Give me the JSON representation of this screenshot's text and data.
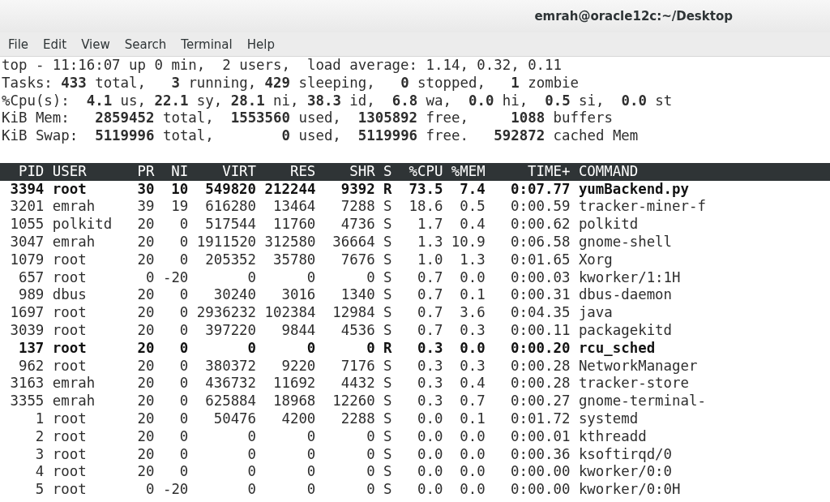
{
  "window": {
    "title": "emrah@oracle12c:~/Desktop"
  },
  "menu": [
    "File",
    "Edit",
    "View",
    "Search",
    "Terminal",
    "Help"
  ],
  "summary": [
    "top - 11:16:07 up 0 min,  2 users,  load average: 1.14, 0.32, 0.11",
    "Tasks: **433** total,   **3** running, **429** sleeping,   **0** stopped,   **1** zombie",
    "%Cpu(s):  **4.1** us, **22.1** sy, **28.1** ni, **38.3** id,  **6.8** wa,  **0.0** hi,  **0.5** si,  **0.0** st",
    "KiB Mem:   **2859452** total,  **1553560** used,  **1305892** free,     **1088** buffers",
    "KiB Swap:  **5119996** total,        **0** used,  **5119996** free.   **592872** cached Mem"
  ],
  "table": {
    "columns": [
      "PID",
      "USER",
      "PR",
      "NI",
      "VIRT",
      "RES",
      "SHR",
      "S",
      "%CPU",
      "%MEM",
      "TIME+",
      "COMMAND"
    ],
    "rows": [
      {
        "highlighted": true,
        "cells": [
          "3394",
          "root",
          "30",
          "10",
          "549820",
          "212244",
          "9392",
          "R",
          "73.5",
          "7.4",
          "0:07.77",
          "yumBackend.py"
        ]
      },
      {
        "highlighted": false,
        "cells": [
          "3201",
          "emrah",
          "39",
          "19",
          "616280",
          "13464",
          "7288",
          "S",
          "18.6",
          "0.5",
          "0:00.59",
          "tracker-miner-f"
        ]
      },
      {
        "highlighted": false,
        "cells": [
          "1055",
          "polkitd",
          "20",
          "0",
          "517544",
          "11760",
          "4736",
          "S",
          "1.7",
          "0.4",
          "0:00.62",
          "polkitd"
        ]
      },
      {
        "highlighted": false,
        "cells": [
          "3047",
          "emrah",
          "20",
          "0",
          "1911520",
          "312580",
          "36664",
          "S",
          "1.3",
          "10.9",
          "0:06.58",
          "gnome-shell"
        ]
      },
      {
        "highlighted": false,
        "cells": [
          "1079",
          "root",
          "20",
          "0",
          "205352",
          "35780",
          "7676",
          "S",
          "1.0",
          "1.3",
          "0:01.65",
          "Xorg"
        ]
      },
      {
        "highlighted": false,
        "cells": [
          "657",
          "root",
          "0",
          "-20",
          "0",
          "0",
          "0",
          "S",
          "0.7",
          "0.0",
          "0:00.03",
          "kworker/1:1H"
        ]
      },
      {
        "highlighted": false,
        "cells": [
          "989",
          "dbus",
          "20",
          "0",
          "30240",
          "3016",
          "1340",
          "S",
          "0.7",
          "0.1",
          "0:00.31",
          "dbus-daemon"
        ]
      },
      {
        "highlighted": false,
        "cells": [
          "1697",
          "root",
          "20",
          "0",
          "2936232",
          "102384",
          "12984",
          "S",
          "0.7",
          "3.6",
          "0:04.35",
          "java"
        ]
      },
      {
        "highlighted": false,
        "cells": [
          "3039",
          "root",
          "20",
          "0",
          "397220",
          "9844",
          "4536",
          "S",
          "0.7",
          "0.3",
          "0:00.11",
          "packagekitd"
        ]
      },
      {
        "highlighted": true,
        "cells": [
          "137",
          "root",
          "20",
          "0",
          "0",
          "0",
          "0",
          "R",
          "0.3",
          "0.0",
          "0:00.20",
          "rcu_sched"
        ]
      },
      {
        "highlighted": false,
        "cells": [
          "962",
          "root",
          "20",
          "0",
          "380372",
          "9220",
          "7176",
          "S",
          "0.3",
          "0.3",
          "0:00.28",
          "NetworkManager"
        ]
      },
      {
        "highlighted": false,
        "cells": [
          "3163",
          "emrah",
          "20",
          "0",
          "436732",
          "11692",
          "4432",
          "S",
          "0.3",
          "0.4",
          "0:00.28",
          "tracker-store"
        ]
      },
      {
        "highlighted": false,
        "cells": [
          "3355",
          "emrah",
          "20",
          "0",
          "625884",
          "18968",
          "12260",
          "S",
          "0.3",
          "0.7",
          "0:00.27",
          "gnome-terminal-"
        ]
      },
      {
        "highlighted": false,
        "cells": [
          "1",
          "root",
          "20",
          "0",
          "50476",
          "4200",
          "2288",
          "S",
          "0.0",
          "0.1",
          "0:01.72",
          "systemd"
        ]
      },
      {
        "highlighted": false,
        "cells": [
          "2",
          "root",
          "20",
          "0",
          "0",
          "0",
          "0",
          "S",
          "0.0",
          "0.0",
          "0:00.01",
          "kthreadd"
        ]
      },
      {
        "highlighted": false,
        "cells": [
          "3",
          "root",
          "20",
          "0",
          "0",
          "0",
          "0",
          "S",
          "0.0",
          "0.0",
          "0:00.36",
          "ksoftirqd/0"
        ]
      },
      {
        "highlighted": false,
        "cells": [
          "4",
          "root",
          "20",
          "0",
          "0",
          "0",
          "0",
          "S",
          "0.0",
          "0.0",
          "0:00.00",
          "kworker/0:0"
        ]
      },
      {
        "highlighted": false,
        "cells": [
          "5",
          "root",
          "0",
          "-20",
          "0",
          "0",
          "0",
          "S",
          "0.0",
          "0.0",
          "0:00.00",
          "kworker/0:0H"
        ]
      }
    ]
  }
}
